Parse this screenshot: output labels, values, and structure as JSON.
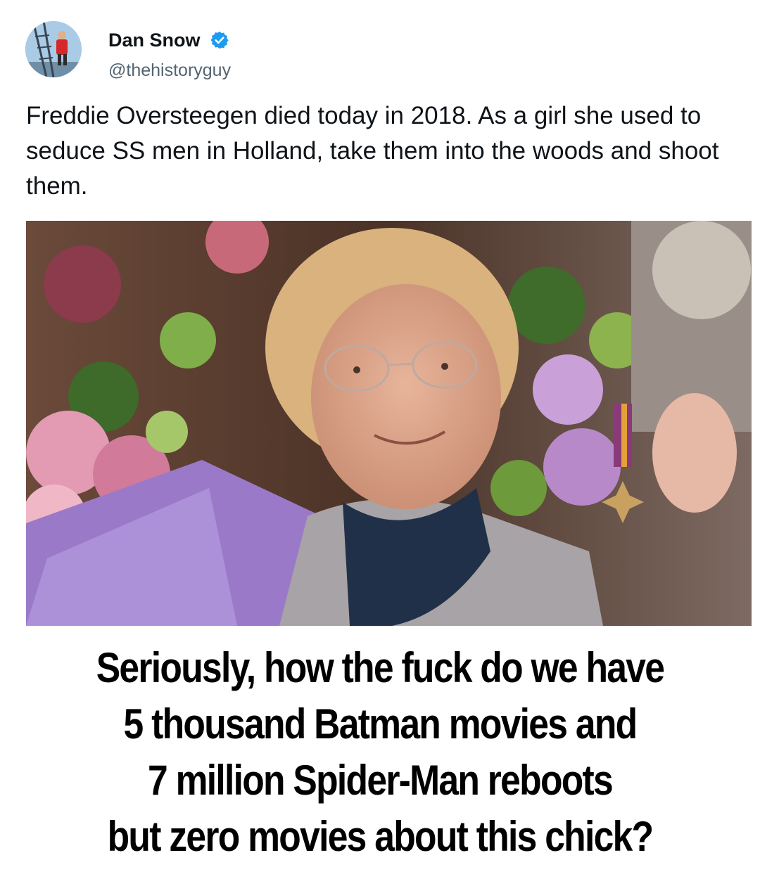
{
  "tweet": {
    "author_name": "Dan Snow",
    "author_handle": "@thehistoryguy",
    "verified": true,
    "avatar_icon": "avatar-photo",
    "verified_icon": "verified-badge-icon",
    "text": "Freddie Oversteegen died today in 2018. As a girl she used to seduce SS men in Holland, take them into the woods and shoot them.",
    "photo_icon": "photo-elderly-woman-holding-medal"
  },
  "caption": {
    "lines": [
      "Seriously, how the fuck do we have",
      "5 thousand Batman movies and",
      "7 million Spider-Man reboots",
      "but zero movies about this chick?"
    ]
  },
  "colors": {
    "verified_blue": "#1d9bf0",
    "handle_gray": "#536471",
    "text_dark": "#0f1419"
  }
}
